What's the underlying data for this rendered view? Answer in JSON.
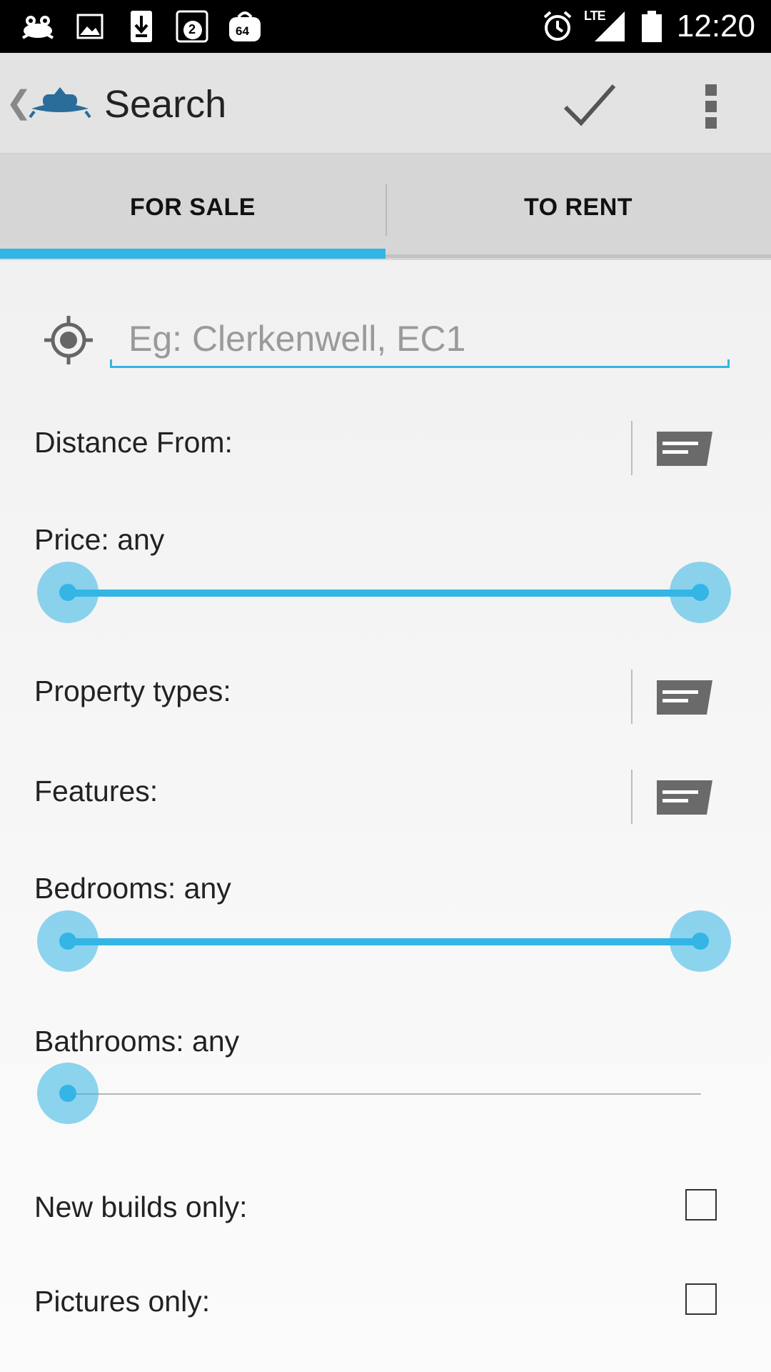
{
  "status_bar": {
    "time": "12:20",
    "network": "LTE",
    "notification_badges": [
      "2",
      "64"
    ],
    "icons": [
      "frog-app-icon",
      "image-icon",
      "download-icon",
      "notification-2-icon",
      "bag-64-icon",
      "alarm-icon",
      "signal-icon",
      "battery-icon"
    ]
  },
  "action_bar": {
    "title": "Search",
    "back_symbol": "❮",
    "logo_icon": "app-logo-icon",
    "confirm_icon": "check-icon",
    "overflow_icon": "overflow-menu-icon"
  },
  "tabs": [
    {
      "label": "FOR SALE",
      "selected": true
    },
    {
      "label": "TO RENT",
      "selected": false
    }
  ],
  "search": {
    "placeholder": "Eg: Clerkenwell, EC1",
    "value": "",
    "location_icon": "gps-target-icon"
  },
  "form": {
    "distance_label": "Distance From:",
    "price_label": "Price: any",
    "property_types_label": "Property types:",
    "features_label": "Features:",
    "bedrooms_label": "Bedrooms: any",
    "bathrooms_label": "Bathrooms: any",
    "new_builds_label": "New builds only:",
    "new_builds_checked": false,
    "pictures_label": "Pictures only:",
    "pictures_checked": false
  },
  "sliders": {
    "price": {
      "min_fraction": 0,
      "max_fraction": 1
    },
    "bedrooms": {
      "min_fraction": 0,
      "max_fraction": 1
    },
    "bathrooms": {
      "min_fraction": 0
    }
  },
  "colors": {
    "accent": "#33b5e5",
    "status_bar": "#000000",
    "action_bar": "#e3e3e3",
    "tab_bar": "#d6d6d6"
  }
}
